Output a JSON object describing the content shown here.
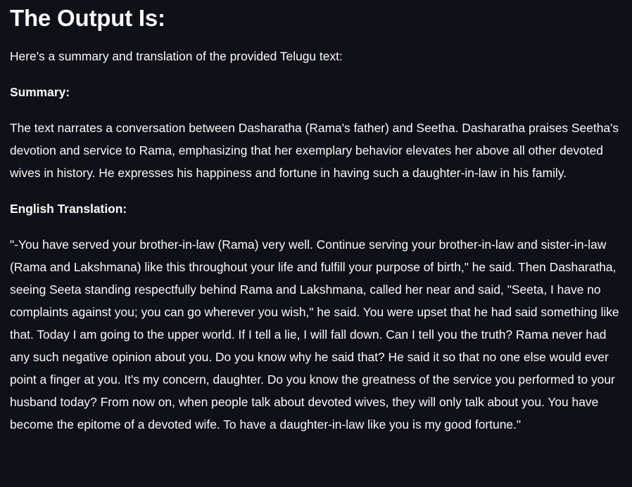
{
  "output": {
    "title": "The Output Is:",
    "intro": "Here's a summary and translation of the provided Telugu text:",
    "summary_heading": "Summary:",
    "summary_text": "The text narrates a conversation between Dasharatha (Rama's father) and Seetha. Dasharatha praises Seetha's devotion and service to Rama, emphasizing that her exemplary behavior elevates her above all other devoted wives in history. He expresses his happiness and fortune in having such a daughter-in-law in his family.",
    "translation_heading": "English Translation:",
    "translation_text": "\"-You have served your brother-in-law (Rama) very well. Continue serving your brother-in-law and sister-in-law (Rama and Lakshmana) like this throughout your life and fulfill your purpose of birth,\" he said. Then Dasharatha, seeing Seeta standing respectfully behind Rama and Lakshmana, called her near and said, \"Seeta, I have no complaints against you; you can go wherever you wish,\" he said. You were upset that he had said something like that. Today I am going to the upper world. If I tell a lie, I will fall down. Can I tell you the truth? Rama never had any such negative opinion about you. Do you know why he said that? He said it so that no one else would ever point a finger at you. It's my concern, daughter. Do you know the greatness of the service you performed to your husband today? From now on, when people talk about devoted wives, they will only talk about you. You have become the epitome of a devoted wife. To have a daughter-in-law like you is my good fortune.\""
  },
  "colors": {
    "background": "#0e1117",
    "text": "#fafafa"
  }
}
